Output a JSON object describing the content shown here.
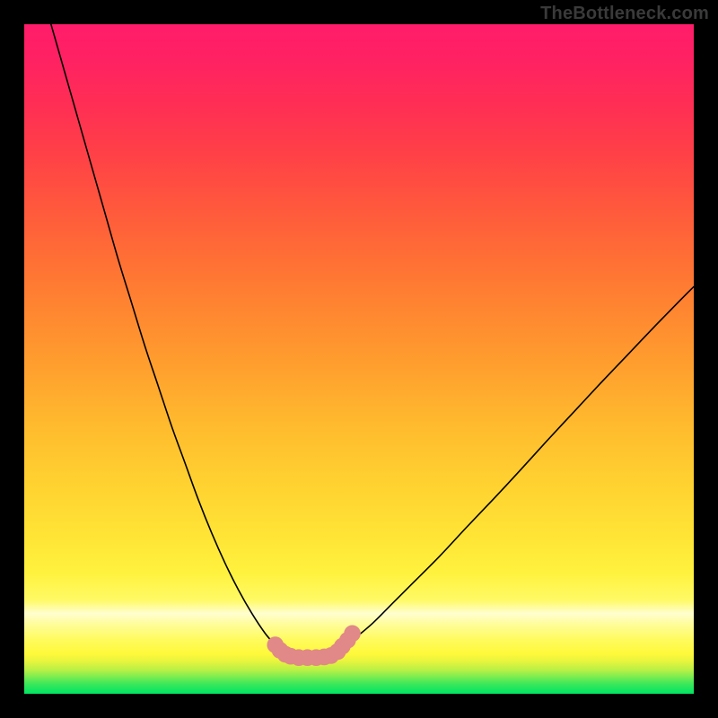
{
  "watermark": "TheBottleneck.com",
  "chart_data": {
    "type": "line",
    "title": "",
    "xlabel": "",
    "ylabel": "",
    "xlim": [
      0,
      100
    ],
    "ylim": [
      0,
      100
    ],
    "grid": false,
    "series": [
      {
        "name": "left-curve",
        "color": "#000000",
        "width": 1.6,
        "x": [
          4,
          6,
          8,
          10,
          12,
          14,
          16,
          18,
          20,
          22,
          24,
          26,
          28,
          30,
          32,
          34,
          36,
          37.5
        ],
        "y": [
          100,
          93,
          86,
          79,
          72,
          65,
          58.5,
          52,
          46,
          40,
          34.5,
          29,
          24,
          19.5,
          15.5,
          12,
          9,
          7.3
        ]
      },
      {
        "name": "right-curve",
        "color": "#000000",
        "width": 1.6,
        "x": [
          47,
          49,
          52,
          55,
          58,
          62,
          66,
          70,
          74,
          78,
          82,
          86,
          90,
          94,
          98,
          100
        ],
        "y": [
          6.5,
          8,
          10.5,
          13.5,
          16.5,
          20.5,
          24.8,
          29,
          33.3,
          37.7,
          42,
          46.3,
          50.5,
          54.7,
          58.8,
          60.8
        ]
      },
      {
        "name": "flat-valley",
        "color": "#000000",
        "width": 1.6,
        "x": [
          39.5,
          41,
          43,
          45,
          46
        ],
        "y": [
          5.6,
          5.4,
          5.4,
          5.5,
          5.7
        ]
      }
    ],
    "marker_series": [
      {
        "name": "valley-markers",
        "color": "#e18888",
        "radius_pct": 1.25,
        "points": [
          {
            "x": 37.5,
            "y": 7.3
          },
          {
            "x": 38.2,
            "y": 6.5
          },
          {
            "x": 39.0,
            "y": 5.9
          },
          {
            "x": 39.8,
            "y": 5.6
          },
          {
            "x": 41.0,
            "y": 5.4
          },
          {
            "x": 42.3,
            "y": 5.4
          },
          {
            "x": 43.6,
            "y": 5.4
          },
          {
            "x": 44.8,
            "y": 5.5
          },
          {
            "x": 45.8,
            "y": 5.7
          },
          {
            "x": 46.8,
            "y": 6.3
          },
          {
            "x": 47.5,
            "y": 7.1
          },
          {
            "x": 48.3,
            "y": 8.0
          },
          {
            "x": 49.0,
            "y": 9.0
          }
        ]
      }
    ],
    "breaks": [
      {
        "between_series": [
          "left-curve",
          "flat-valley"
        ]
      },
      {
        "between_series": [
          "flat-valley",
          "right-curve"
        ]
      }
    ]
  }
}
